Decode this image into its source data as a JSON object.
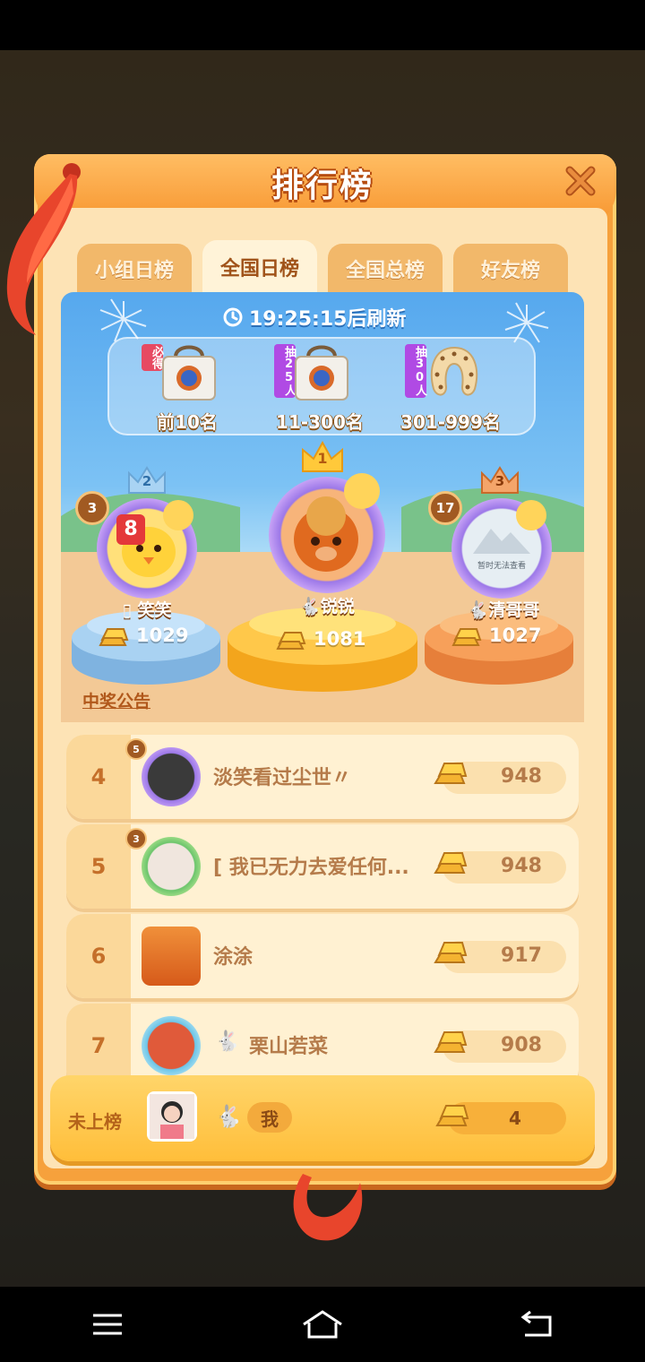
{
  "panel": {
    "title": "排行榜"
  },
  "tabs": [
    {
      "label": "小组日榜",
      "active": false
    },
    {
      "label": "全国日榜",
      "active": true
    },
    {
      "label": "全国总榜",
      "active": false
    },
    {
      "label": "好友榜",
      "active": false
    }
  ],
  "refresh_text": "19:25:15后刷新",
  "prizes": [
    {
      "tag": "必得",
      "tag_color": "#e74a62",
      "label": "前10名",
      "icon": "bag-icon"
    },
    {
      "tag": "抽25人",
      "tag_color": "#b04ae4",
      "label": "11-300名",
      "icon": "bag-icon"
    },
    {
      "tag": "抽30人",
      "tag_color": "#b04ae4",
      "label": "301-999名",
      "icon": "neck-pillow-icon"
    }
  ],
  "podium": {
    "first": {
      "rank": "1",
      "name": "锐锐",
      "score": "1081"
    },
    "second": {
      "rank": "2",
      "name": "笑笑",
      "name_prefix": "▯",
      "score": "1029",
      "level": "3",
      "badge": "8"
    },
    "third": {
      "rank": "3",
      "name": "清哥哥",
      "score": "1027",
      "level": "17",
      "avatar_text": "暂时无法查看"
    }
  },
  "notice_label": "中奖公告",
  "rows": [
    {
      "rank": "4",
      "name": "淡笑看过尘世〃",
      "score": "948",
      "level": "5"
    },
    {
      "rank": "5",
      "name": "[ 我已无力去爱任何...",
      "score": "948",
      "level": "3"
    },
    {
      "rank": "6",
      "name": "涂涂",
      "score": "917"
    },
    {
      "rank": "7",
      "name": "栗山若菜",
      "score": "908"
    }
  ],
  "me": {
    "status": "未上榜",
    "name": "我",
    "score": "4"
  },
  "colors": {
    "accent": "#f6a13c",
    "panel_bg": "#fde3b5",
    "gold": "#ffbe3a"
  }
}
